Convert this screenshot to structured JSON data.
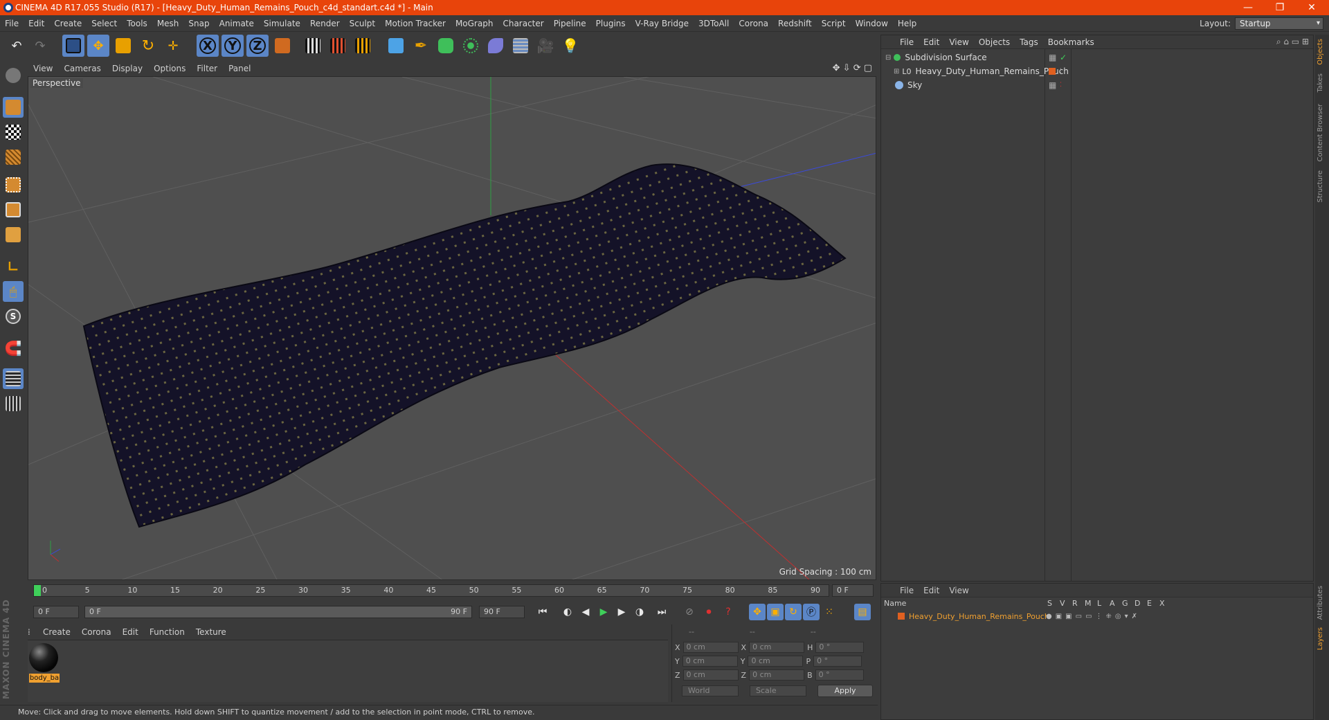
{
  "window": {
    "title": "CINEMA 4D R17.055 Studio (R17) - [Heavy_Duty_Human_Remains_Pouch_c4d_standart.c4d *] - Main",
    "controls": [
      "—",
      "❐",
      "✕"
    ]
  },
  "menubar": {
    "items": [
      "File",
      "Edit",
      "Create",
      "Select",
      "Tools",
      "Mesh",
      "Snap",
      "Animate",
      "Simulate",
      "Render",
      "Sculpt",
      "Motion Tracker",
      "MoGraph",
      "Character",
      "Pipeline",
      "Plugins",
      "V-Ray Bridge",
      "3DToAll",
      "Corona",
      "Redshift",
      "Script",
      "Window",
      "Help"
    ],
    "layout_label": "Layout:",
    "layout_value": "Startup"
  },
  "toolbar": {
    "axis_x": "X",
    "axis_y": "Y",
    "axis_z": "Z"
  },
  "viewport": {
    "menu": [
      "View",
      "Cameras",
      "Display",
      "Options",
      "Filter",
      "Panel"
    ],
    "label": "Perspective",
    "grid_spacing": "Grid Spacing : 100 cm"
  },
  "timeline": {
    "ticks": [
      "0",
      "5",
      "10",
      "15",
      "20",
      "25",
      "30",
      "35",
      "40",
      "45",
      "50",
      "55",
      "60",
      "65",
      "70",
      "75",
      "80",
      "85",
      "90"
    ],
    "current_frame": "0 F",
    "start_field": "0 F",
    "range_start": "0 F",
    "range_end": "90 F",
    "end_field": "90 F"
  },
  "material_manager": {
    "menu": [
      "Create",
      "Corona",
      "Edit",
      "Function",
      "Texture"
    ],
    "materials": [
      {
        "name": "body_ba"
      }
    ]
  },
  "coordinates": {
    "headers": [
      "--",
      "--",
      "--"
    ],
    "rows": [
      {
        "a": "X",
        "v1": "0 cm",
        "b": "X",
        "v2": "0 cm",
        "c": "H",
        "v3": "0 °"
      },
      {
        "a": "Y",
        "v1": "0 cm",
        "b": "Y",
        "v2": "0 cm",
        "c": "P",
        "v3": "0 °"
      },
      {
        "a": "Z",
        "v1": "0 cm",
        "b": "Z",
        "v2": "0 cm",
        "c": "B",
        "v3": "0 °"
      }
    ],
    "mode1": "World",
    "mode2": "Scale",
    "apply": "Apply"
  },
  "object_manager": {
    "menu": [
      "File",
      "Edit",
      "View",
      "Objects",
      "Tags",
      "Bookmarks"
    ],
    "objects": [
      {
        "name": "Subdivision Surface"
      },
      {
        "name": "Heavy_Duty_Human_Remains_Pouch"
      },
      {
        "name": "Sky"
      }
    ]
  },
  "layer_manager": {
    "menu": [
      "File",
      "Edit",
      "View"
    ],
    "columns": [
      "Name",
      "S",
      "V",
      "R",
      "M",
      "L",
      "A",
      "G",
      "D",
      "E",
      "X"
    ],
    "layers": [
      {
        "name": "Heavy_Duty_Human_Remains_Pouch"
      }
    ]
  },
  "side_tabs": [
    "Objects",
    "Takes",
    "Content Browser",
    "Structure"
  ],
  "side_tabs_bottom": [
    "Attributes",
    "Layers"
  ],
  "status": "Move: Click and drag to move elements. Hold down SHIFT to quantize movement / add to the selection in point mode, CTRL to remove.",
  "brand": "MAXON CINEMA 4D",
  "colors": {
    "accent": "#e8440b",
    "selected": "#5b86c7",
    "layer_orange": "#e06020",
    "layer_text": "#f0a030"
  }
}
